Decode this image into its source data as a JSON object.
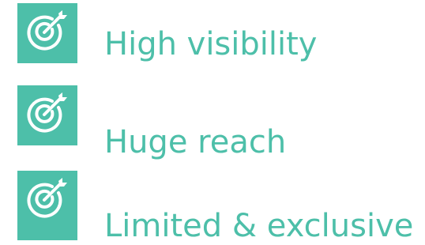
{
  "colors": {
    "accent": "#4dbfa9",
    "background": "#ffffff"
  },
  "features": [
    {
      "icon": "target-arrow-icon",
      "label": "High visibility"
    },
    {
      "icon": "target-arrow-icon",
      "label": "Huge reach"
    },
    {
      "icon": "target-arrow-icon",
      "label": "Limited & exclusive"
    }
  ]
}
